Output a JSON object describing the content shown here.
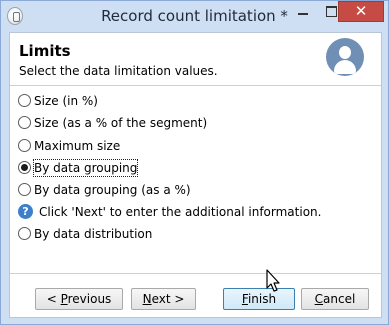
{
  "window": {
    "title": "Record count limitation *",
    "close_glyph": "✕"
  },
  "header": {
    "title": "Limits",
    "subtitle": "Select the data limitation values.",
    "icon": "user-avatar-icon"
  },
  "options": [
    {
      "label": "Size (in %)",
      "checked": false
    },
    {
      "label": "Size (as a % of the segment)",
      "checked": false
    },
    {
      "label": "Maximum size",
      "checked": false
    },
    {
      "label": "By data grouping",
      "checked": true
    },
    {
      "label": "By data grouping (as a %)",
      "checked": false
    },
    {
      "label": "By data distribution",
      "checked": false
    }
  ],
  "info": {
    "icon_glyph": "?",
    "text": "Click 'Next' to enter the additional information."
  },
  "buttons": {
    "previous_prefix": "< ",
    "previous_mnemonic": "P",
    "previous_rest": "revious",
    "next_mnemonic": "N",
    "next_rest": "ext >",
    "finish_mnemonic": "F",
    "finish_rest": "inish",
    "cancel_mnemonic": "C",
    "cancel_rest": "ancel"
  },
  "colors": {
    "title_bar": "#cfdff3",
    "close_button": "#c74b45",
    "avatar": "#6f8fb5",
    "info_icon": "#3d7fc8",
    "default_button_border": "#3c7fb1"
  }
}
